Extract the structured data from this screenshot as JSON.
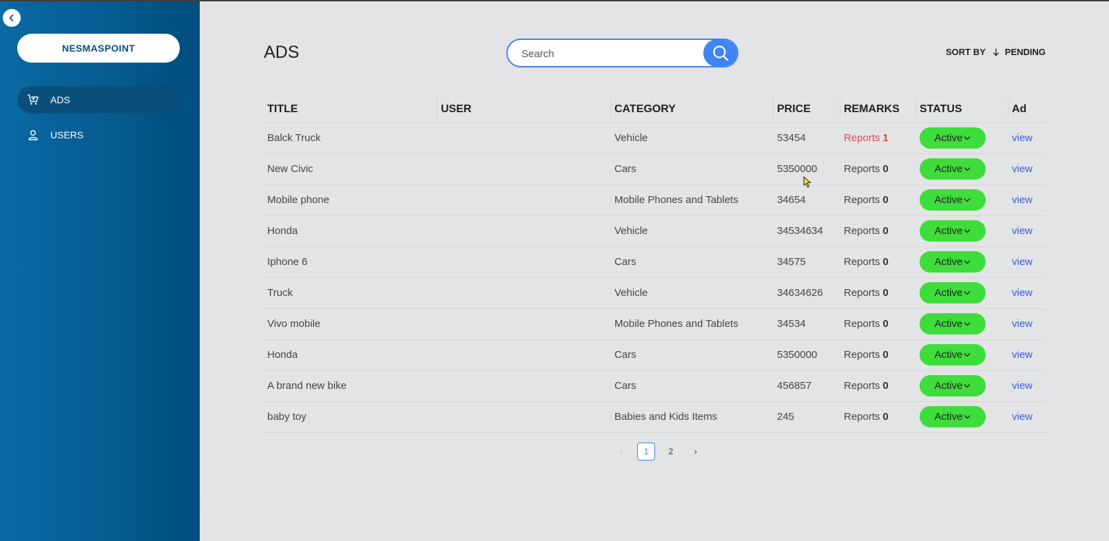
{
  "sidebar": {
    "brand": "NESMASPOINT",
    "items": [
      {
        "label": "ADS",
        "icon": "cart-icon",
        "active": true
      },
      {
        "label": "USERS",
        "icon": "user-icon",
        "active": false
      }
    ],
    "stray_char": ";"
  },
  "header": {
    "title": "ADS",
    "search_placeholder": "Search",
    "sort_label": "SORT BY",
    "sort_value": "PENDING"
  },
  "table": {
    "columns": [
      "TITLE",
      "USER",
      "CATEGORY",
      "PRICE",
      "REMARKS",
      "STATUS",
      "Ad"
    ],
    "rows": [
      {
        "title": "Balck Truck",
        "user": "",
        "category": "Vehicle",
        "price": "53454",
        "remarks_label": "Reports",
        "remarks_count": "1",
        "status": "Active",
        "action": "view"
      },
      {
        "title": "New Civic",
        "user": "",
        "category": "Cars",
        "price": "5350000",
        "remarks_label": "Reports",
        "remarks_count": "0",
        "status": "Active",
        "action": "view"
      },
      {
        "title": "Mobile phone",
        "user": "",
        "category": "Mobile Phones and Tablets",
        "price": "34654",
        "remarks_label": "Reports",
        "remarks_count": "0",
        "status": "Active",
        "action": "view"
      },
      {
        "title": "Honda",
        "user": "",
        "category": "Vehicle",
        "price": "34534634",
        "remarks_label": "Reports",
        "remarks_count": "0",
        "status": "Active",
        "action": "view"
      },
      {
        "title": "Iphone 6",
        "user": "",
        "category": "Cars",
        "price": "34575",
        "remarks_label": "Reports",
        "remarks_count": "0",
        "status": "Active",
        "action": "view"
      },
      {
        "title": "Truck",
        "user": "",
        "category": "Vehicle",
        "price": "34634626",
        "remarks_label": "Reports",
        "remarks_count": "0",
        "status": "Active",
        "action": "view"
      },
      {
        "title": "Vivo mobile",
        "user": "",
        "category": "Mobile Phones and Tablets",
        "price": "34534",
        "remarks_label": "Reports",
        "remarks_count": "0",
        "status": "Active",
        "action": "view"
      },
      {
        "title": "Honda",
        "user": "",
        "category": "Cars",
        "price": "5350000",
        "remarks_label": "Reports",
        "remarks_count": "0",
        "status": "Active",
        "action": "view"
      },
      {
        "title": "A brand new bike",
        "user": "",
        "category": "Cars",
        "price": "456857",
        "remarks_label": "Reports",
        "remarks_count": "0",
        "status": "Active",
        "action": "view"
      },
      {
        "title": "baby toy",
        "user": "",
        "category": "Babies and Kids Items",
        "price": "245",
        "remarks_label": "Reports",
        "remarks_count": "0",
        "status": "Active",
        "action": "view"
      }
    ]
  },
  "pagination": {
    "prev": "‹",
    "pages": [
      "1",
      "2"
    ],
    "current": "1",
    "next": "›"
  },
  "colors": {
    "accent": "#3f84f0",
    "status_active": "#3fdd3c",
    "report_alert": "#e04b4b",
    "sidebar": "#0a6aa4"
  }
}
